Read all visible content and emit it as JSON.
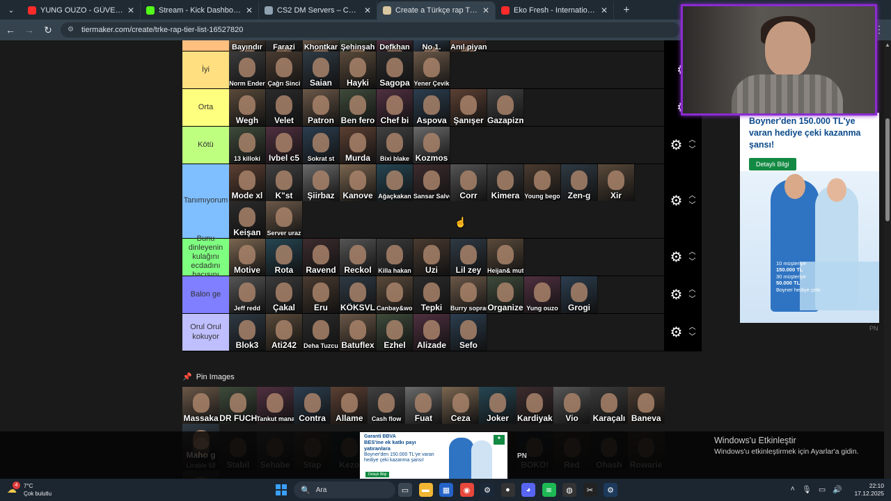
{
  "browser": {
    "tabs": [
      {
        "title": "YUNG OUZO - GÜVENEMEM - You",
        "favicon_color": "#ff2b2b",
        "active": false
      },
      {
        "title": "Stream - Kick Dashboard",
        "favicon_color": "#53fc18",
        "active": false
      },
      {
        "title": "CS2 DM Servers – CYBERSHOKE",
        "favicon_color": "#8fa3b3",
        "active": false
      },
      {
        "title": "Create a Türkçe rap Tier List - Tie",
        "favicon_color": "#d8c7a0",
        "active": true
      },
      {
        "title": "Eko Fresh - International Nighty",
        "favicon_color": "#ff2b2b",
        "active": false
      }
    ],
    "url": "tiermaker.com/create/trke-rap-tier-list-16527820"
  },
  "top_strip": [
    "Bayındır",
    "Farazi",
    "Khontkar",
    "Şehinşah",
    "Defkhan",
    "No 1.",
    "Anıl piyanci"
  ],
  "tiers": [
    {
      "label": "İyi",
      "color": "#ffdf7f",
      "items": [
        "Norm Ender",
        "Çağrı Sinci",
        "Saian",
        "Hayki",
        "Sagopa",
        "Yener Çevik"
      ],
      "arrows": false
    },
    {
      "label": "Orta",
      "color": "#ffff7f",
      "items": [
        "Wegh",
        "Velet",
        "Patron",
        "Ben fero",
        "Chef bi",
        "Aspova",
        "Şanışer",
        "Gazapizm"
      ],
      "arrows": false
    },
    {
      "label": "Kötü",
      "color": "#bfff7f",
      "items": [
        "13 killoki",
        "Ivbel c5",
        "Sokrat st",
        "Murda",
        "Bixi blake",
        "Kozmos"
      ],
      "arrows": true
    },
    {
      "label": "Tanımıyorum",
      "color": "#7fbfff",
      "items": [
        "Mode xl",
        "K\"st",
        "Şiirbaz",
        "Kanove",
        "Ağaçkakan",
        "Sansar Salvo",
        "Corr",
        "Kimera",
        "Young bego",
        "Zen-g",
        "Xir",
        "Keişan",
        "Server uraz"
      ],
      "arrows": true
    },
    {
      "label": "Bunu dinleyenin kulağını ecdadını bacısını",
      "color": "#7fff7f",
      "items": [
        "Motive",
        "Rota",
        "Ravend",
        "Reckol",
        "Killa hakan",
        "Uzi",
        "Lil zey",
        "Heijan& muti"
      ],
      "arrows": true
    },
    {
      "label": "Balon ge",
      "color": "#7f7fff",
      "items": [
        "Jeff redd",
        "Çakal",
        "Eru",
        "KÖKSVL",
        "Canbay&wolker",
        "Tepki",
        "Burry soprano",
        "Organize",
        "Yung ouzo",
        "Grogi"
      ],
      "arrows": true
    },
    {
      "label": "Orul Orul kokuyor",
      "color": "#bfbfff",
      "items": [
        "Blok3",
        "Ati242",
        "Deha Tuzcu",
        "Batuflex",
        "Ezhel",
        "Alizade",
        "Sefo"
      ],
      "arrows": true
    }
  ],
  "pin": {
    "title": "Pin Images",
    "items": [
      "Massaka",
      "DR FUCHS",
      "Tankut manas",
      "Contra",
      "Allame",
      "Cash flow",
      "Fuat",
      "Ceza",
      "Joker",
      "Kardiyak",
      "Vio",
      "Karaçalı",
      "Baneva",
      "Maho g"
    ],
    "ghost_items": [
      "Lirable 53",
      "Stabil",
      "Sehabe",
      "Stap",
      "Kezo",
      "",
      "",
      "",
      "PN",
      "BOKO!",
      "Red",
      "Ohash",
      "Rowarie",
      "Kamufle"
    ]
  },
  "ad": {
    "headline": "Boyner'den 150.000 TL'ye varan hediye çeki kazanma şansı!",
    "button": "Detaylı Bilgi",
    "gift_line1": "10 müşteriye",
    "gift_line2": "150.000 TL",
    "gift_line3": "30 müşteriye",
    "gift_line4": "50.000 TL",
    "gift_line5": "Boyner hediye çeki",
    "pn": "PN"
  },
  "bbva_ad": {
    "logo": "Garanti BBVA",
    "line1": "BES'ine ek katkı payı yatıranlara",
    "line2": "Boyner'den 150.000 TL'ye varan hediye çeki kazanma şansı!",
    "button": "Detaylı Bilgi",
    "pn": "PN"
  },
  "windows_activation": {
    "title": "Windows'u Etkinleştir",
    "subtitle": "Windows'u etkinleştirmek için Ayarlar'a gidin."
  },
  "taskbar": {
    "temp": "7°C",
    "weather": "Çok bulutlu",
    "notification_count": "4",
    "search_placeholder": "Ara",
    "time": "22:10",
    "date": "17.12.2025"
  }
}
